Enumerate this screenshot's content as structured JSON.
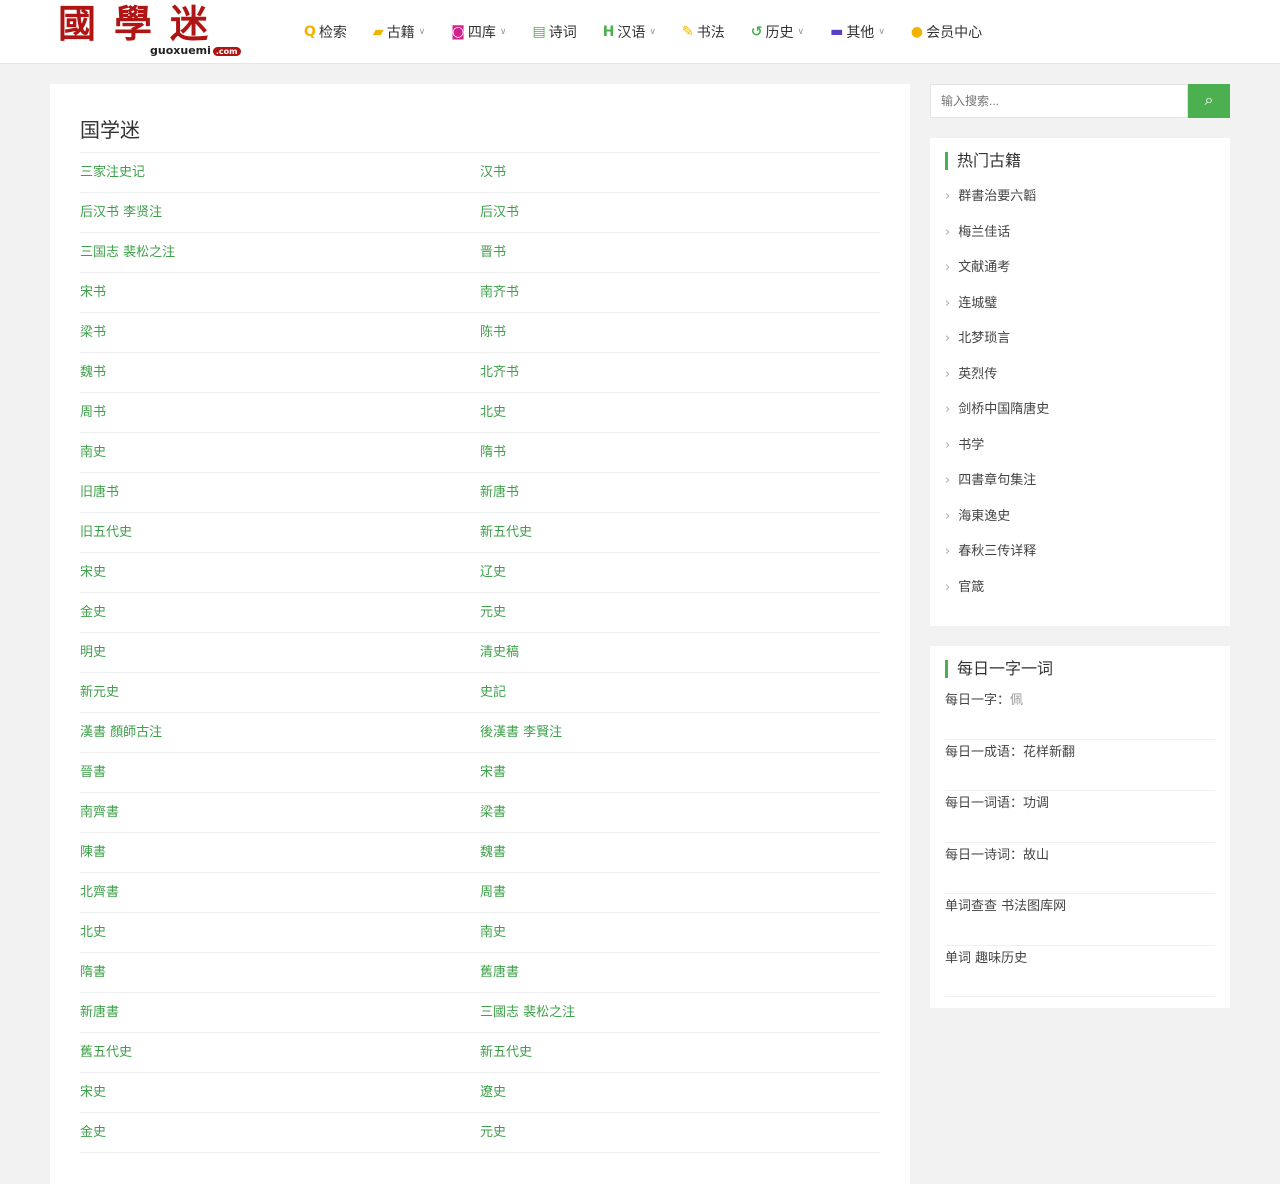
{
  "header": {
    "logo_text": "國學迷",
    "logo_domain": "guoxuemi",
    "logo_tld": ".com",
    "nav": [
      {
        "label": "检索",
        "icon": "search-icon",
        "color": "#f0b400",
        "glyph": "Q",
        "dropdown": false
      },
      {
        "label": "古籍",
        "icon": "book-icon",
        "color": "#f0b400",
        "glyph": "▰",
        "dropdown": true
      },
      {
        "label": "四库",
        "icon": "camera-icon",
        "color": "#d6208c",
        "glyph": "◙",
        "dropdown": true
      },
      {
        "label": "诗词",
        "icon": "file-icon",
        "color": "#4caf50",
        "glyph": "▤",
        "dropdown": false
      },
      {
        "label": "汉语",
        "icon": "h-icon",
        "color": "#4caf50",
        "glyph": "H",
        "dropdown": true
      },
      {
        "label": "书法",
        "icon": "edit-icon",
        "color": "#f0b400",
        "glyph": "✎",
        "dropdown": false
      },
      {
        "label": "历史",
        "icon": "history-icon",
        "color": "#4caf50",
        "glyph": "↺",
        "dropdown": true
      },
      {
        "label": "其他",
        "icon": "folder-icon",
        "color": "#5a3fc0",
        "glyph": "▬",
        "dropdown": true
      },
      {
        "label": "会员中心",
        "icon": "user-icon",
        "color": "#f0b400",
        "glyph": "●",
        "dropdown": false
      }
    ]
  },
  "main": {
    "title": "国学迷",
    "items": [
      "三家注史记",
      "汉书",
      "后汉书 李贤注",
      "后汉书",
      "三国志 裴松之注",
      "晋书",
      "宋书",
      "南齐书",
      "梁书",
      "陈书",
      "魏书",
      "北齐书",
      "周书",
      "北史",
      "南史",
      "隋书",
      "旧唐书",
      "新唐书",
      "旧五代史",
      "新五代史",
      "宋史",
      "辽史",
      "金史",
      "元史",
      "明史",
      "清史稿",
      "新元史",
      "史記",
      "漢書 顏師古注",
      "後漢書 李賢注",
      "晉書",
      "宋書",
      "南齊書",
      "梁書",
      "陳書",
      "魏書",
      "北齊書",
      "周書",
      "北史",
      "南史",
      "隋書",
      "舊唐書",
      "新唐書",
      "三國志 裴松之注",
      "舊五代史",
      "新五代史",
      "宋史",
      "遼史",
      "金史",
      "元史"
    ]
  },
  "sidebar": {
    "search_placeholder": "输入搜索...",
    "hot": {
      "title": "热门古籍",
      "items": [
        "群書治要六韜",
        "梅兰佳话",
        "文献通考",
        "连城璧",
        "北梦琐言",
        "英烈传",
        "剑桥中国隋唐史",
        "书学",
        "四書章句集注",
        "海東逸史",
        "春秋三传详释",
        "官箴"
      ]
    },
    "daily": {
      "title": "每日一字一词",
      "items": [
        {
          "label": "每日一字：",
          "value": "佩"
        },
        {
          "label": "每日一成语：",
          "value": "花样新翻"
        },
        {
          "label": "每日一词语：",
          "value": "功调"
        },
        {
          "label": "每日一诗词：",
          "value": "故山"
        },
        {
          "label": "单词查查 ",
          "value": "书法图库网"
        },
        {
          "label": "单词 ",
          "value": "趣味历史"
        }
      ]
    }
  }
}
